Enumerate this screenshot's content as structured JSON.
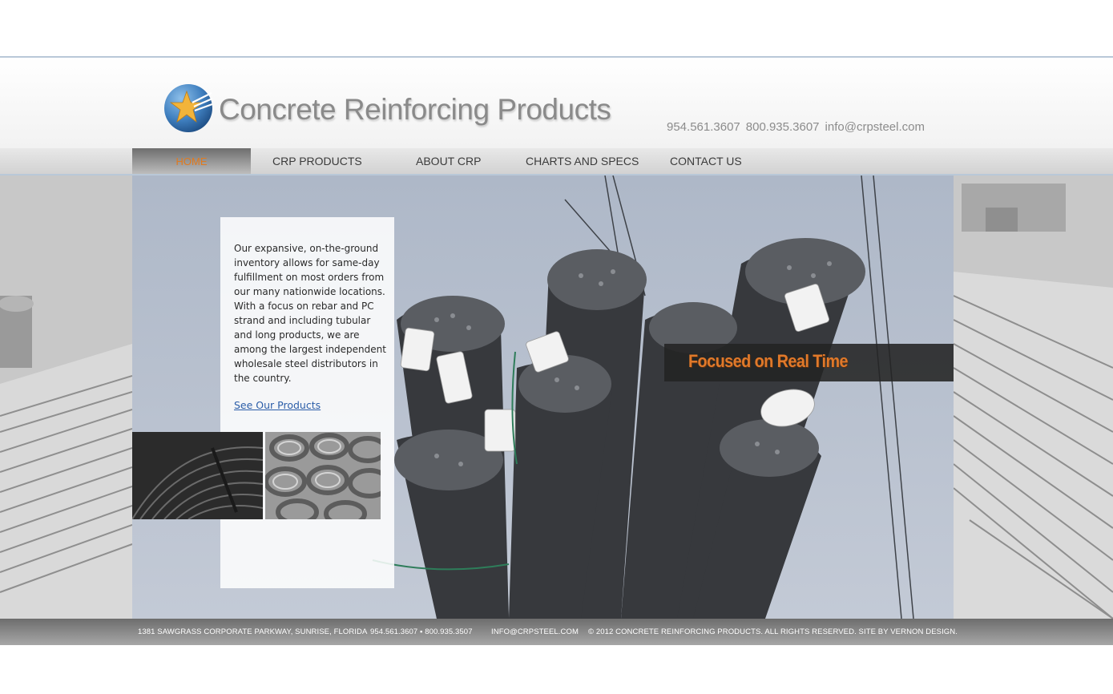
{
  "header": {
    "brand": "Concrete Reinforcing Products",
    "phone1": "954.561.3607",
    "phone2": "800.935.3607",
    "email": "info@crpsteel.com"
  },
  "nav": {
    "items": [
      {
        "label": "HOME",
        "active": true
      },
      {
        "label": "CRP PRODUCTS"
      },
      {
        "label": "ABOUT CRP"
      },
      {
        "label": "CHARTS AND SPECS"
      },
      {
        "label": "CONTACT US"
      }
    ]
  },
  "intro": {
    "text": "Our expansive, on-the-ground inventory allows for same-day fulfillment on most orders from our many nationwide locations. With a focus on rebar and PC strand and including tubular and long products, we are among the largest independent wholesale steel distributors in the country.",
    "link": "See Our Products"
  },
  "banner": {
    "text": "Focused on Real Time"
  },
  "footer": {
    "address": "1381 SAWGRASS CORPORATE PARKWAY, SUNRISE, FLORIDA",
    "phones": "954.561.3607 ▪ 800.935.3507",
    "email": "INFO@CRPSTEEL.COM",
    "copyright": "© 2012 CONCRETE REINFORCING PRODUCTS. ALL RIGHTS RESERVED. SITE BY VERNON DESIGN."
  },
  "colors": {
    "accent": "#e07a1f",
    "link": "#2b5da8",
    "nav_border": "#b9c8d8"
  }
}
